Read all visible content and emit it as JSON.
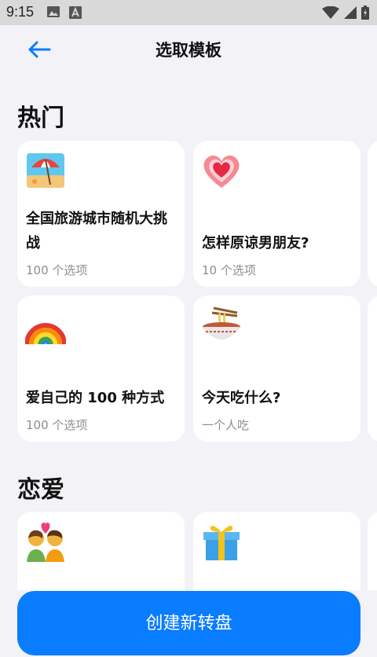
{
  "status_bar": {
    "time": "9:15"
  },
  "header": {
    "title": "选取模板"
  },
  "sections": [
    {
      "title": "热门",
      "cards": [
        {
          "emoji": "beach-umbrella-icon",
          "title": "全国旅游城市随机大挑战",
          "subtitle": "100 个选项"
        },
        {
          "emoji": "heart-icon",
          "title": "怎样原谅男朋友?",
          "subtitle": "10 个选项"
        },
        {
          "emoji": "rainbow-icon",
          "title": "爱自己的 100 种方式",
          "subtitle": "100 个选项"
        },
        {
          "emoji": "noodle-bowl-icon",
          "title": "今天吃什么?",
          "subtitle": "一个人吃"
        }
      ]
    },
    {
      "title": "恋爱",
      "cards": [
        {
          "emoji": "couple-with-heart-icon",
          "title": "",
          "subtitle": ""
        },
        {
          "emoji": "gift-icon",
          "title": "",
          "subtitle": ""
        }
      ]
    }
  ],
  "create_button": {
    "label": "创建新转盘"
  },
  "colors": {
    "accent": "#0a7cff",
    "background": "#f2f2f7",
    "card": "#ffffff",
    "subtext": "#8e8e93"
  }
}
